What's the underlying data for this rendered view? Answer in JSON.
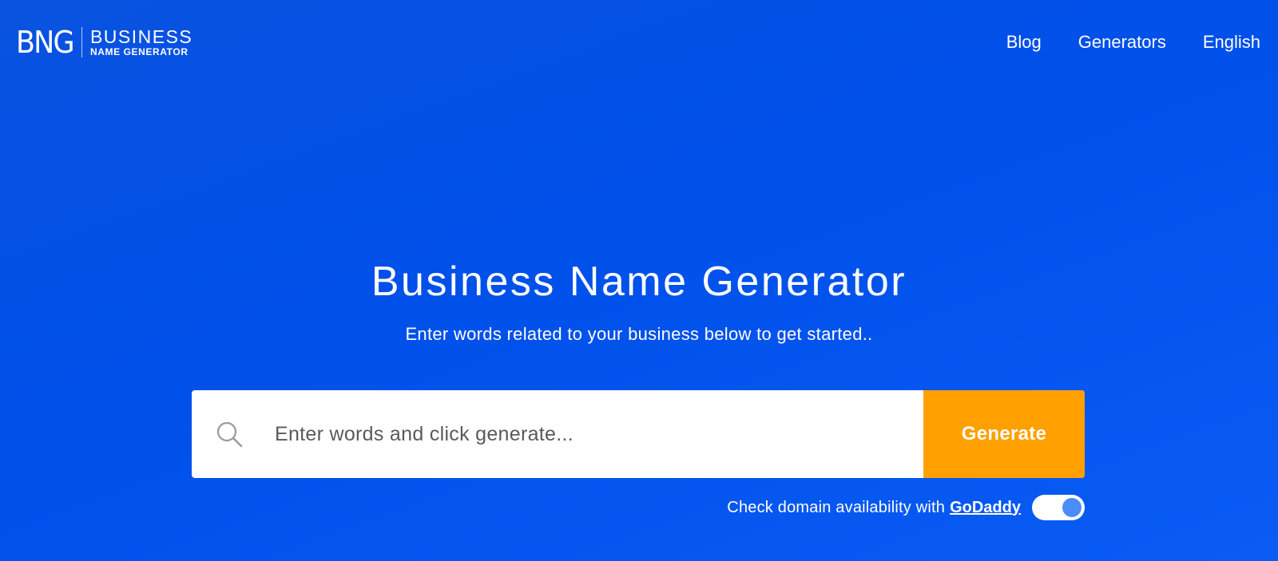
{
  "header": {
    "logo": {
      "mark": "BNG",
      "top": "BUSINESS",
      "bottom": "NAME GENERATOR"
    },
    "nav": [
      {
        "label": "Blog"
      },
      {
        "label": "Generators"
      },
      {
        "label": "English"
      }
    ]
  },
  "hero": {
    "title": "Business Name Generator",
    "subtitle": "Enter words related to your business below to get started.."
  },
  "search": {
    "placeholder": "Enter words and click generate...",
    "value": "",
    "icon": "search-icon",
    "button_label": "Generate"
  },
  "domain_check": {
    "text": "Check domain availability with",
    "link_label": "GoDaddy",
    "toggle_on": true
  },
  "colors": {
    "background": "#0050ea",
    "accent": "#ffa000",
    "toggle_knob": "#4a8df8"
  }
}
